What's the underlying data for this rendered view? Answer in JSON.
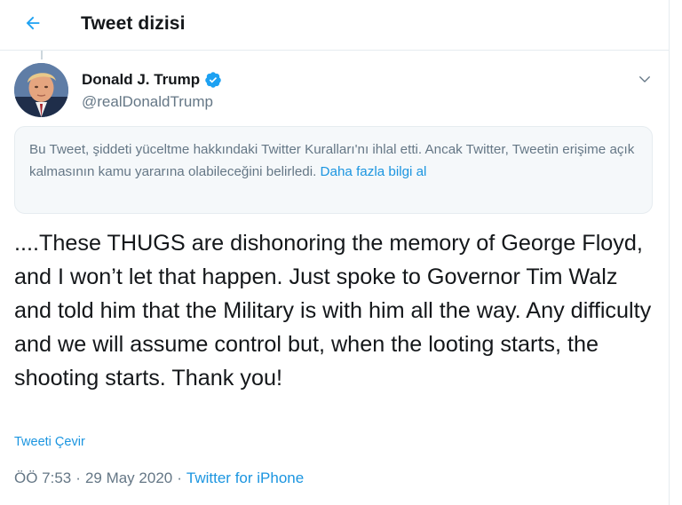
{
  "colors": {
    "accent": "#1da1f2",
    "link": "#1b95e0",
    "secondary_text": "#657786",
    "primary_text": "#14171a",
    "notice_bg": "#f5f8fa",
    "border": "#e6ecf0"
  },
  "header": {
    "back_icon": "arrow-left-icon",
    "title": "Tweet dizisi"
  },
  "author": {
    "name": "Donald J. Trump",
    "handle": "@realDonaldTrump",
    "verified_icon": "verified-badge-icon",
    "more_icon": "chevron-down-icon"
  },
  "notice": {
    "text": "Bu Tweet, şiddeti yüceltme hakkındaki Twitter Kuralları'nı ihlal etti. Ancak Twitter, Tweetin erişime açık kalmasının kamu yararına olabileceğini belirledi.",
    "link": "Daha fazla bilgi al"
  },
  "tweet": {
    "text": "....These THUGS are dishonoring the memory of George Floyd, and I won’t let that happen. Just spoke to Governor Tim Walz and told him that the Military is with him all the way. Any difficulty and we will assume control but, when the looting starts, the shooting starts. Thank you!",
    "translate_label": "Tweeti Çevir",
    "time": "ÖÖ 7:53",
    "separator": "·",
    "date": "29 May 2020",
    "source": "Twitter for iPhone"
  }
}
